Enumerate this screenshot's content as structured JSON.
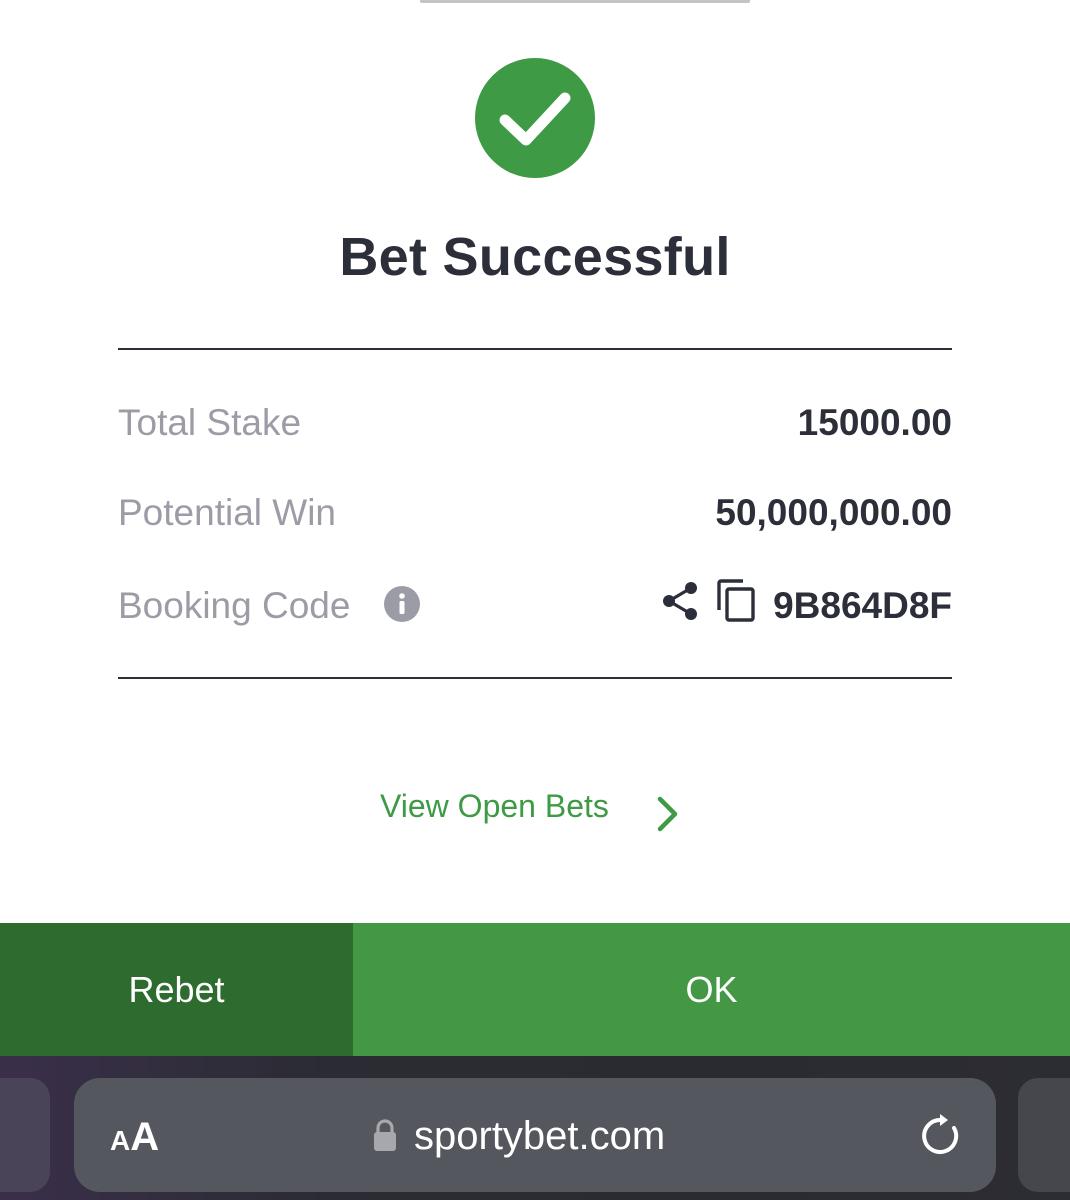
{
  "dialog": {
    "title": "Bet Successful",
    "rows": [
      {
        "label": "Total Stake",
        "value": "15000.00"
      },
      {
        "label": "Potential Win",
        "value": "50,000,000.00"
      },
      {
        "label": "Booking Code",
        "value": "9B864D8F"
      }
    ],
    "view_open_bets": "View Open Bets",
    "buttons": {
      "rebet": "Rebet",
      "ok": "OK"
    }
  },
  "browser": {
    "text_size_small": "A",
    "text_size_large": "A",
    "url": "sportybet.com"
  },
  "icons": {
    "success": "checkmark-circle",
    "info": "info-circle",
    "share": "share-nodes",
    "copy": "copy-squares",
    "chevron": "chevron-right",
    "lock": "padlock",
    "reload": "circular-arrow"
  },
  "colors": {
    "accent_green": "#449845",
    "dark_green": "#2d6b2f",
    "text_dark": "#2c2f3a",
    "text_muted": "#9b9ca6"
  }
}
